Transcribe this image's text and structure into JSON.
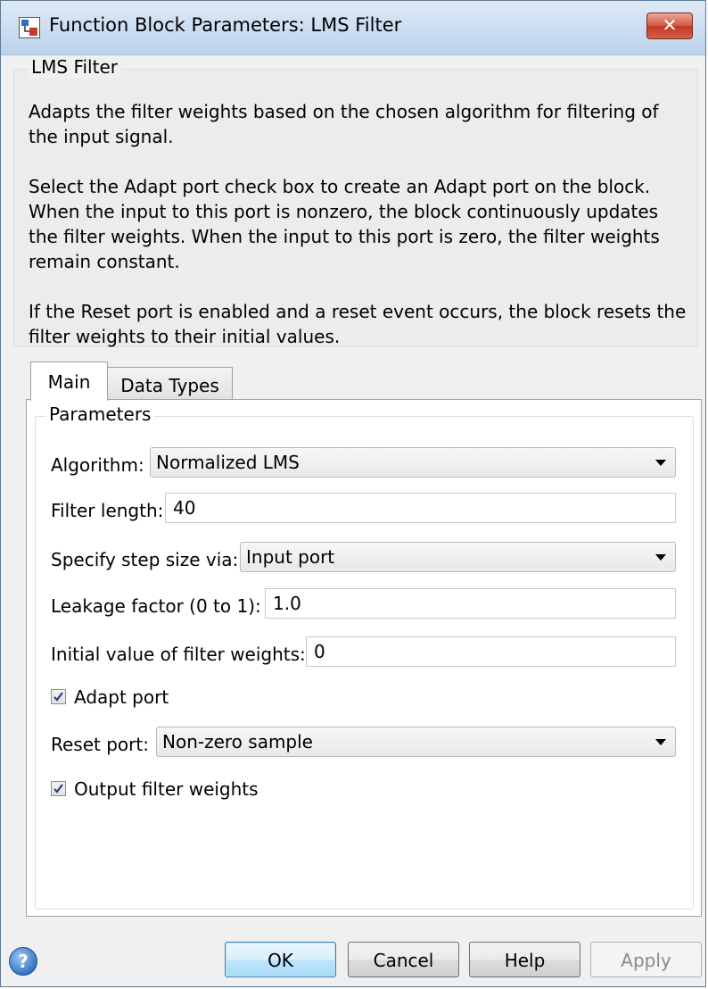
{
  "window": {
    "title": "Function Block Parameters: LMS Filter",
    "close_glyph": "✕"
  },
  "description": {
    "legend": "LMS Filter",
    "paragraphs": [
      "Adapts the filter weights based on the chosen algorithm for filtering of the input signal.",
      "Select the Adapt port check box to create an Adapt port on the block. When the input to this port is nonzero, the block continuously updates the filter weights. When the input to this port is zero, the filter weights remain constant.",
      "If the Reset port is enabled and a reset event occurs, the block resets the filter weights to their initial values."
    ]
  },
  "tabs": [
    {
      "label": "Main",
      "selected": true
    },
    {
      "label": "Data Types",
      "selected": false
    }
  ],
  "parameters": {
    "legend": "Parameters",
    "algorithm": {
      "label": "Algorithm:",
      "value": "Normalized LMS"
    },
    "filter_length": {
      "label": "Filter length:",
      "value": "40"
    },
    "step_size": {
      "label": "Specify step size via:",
      "value": "Input port"
    },
    "leakage": {
      "label": "Leakage factor (0 to 1):",
      "value": "1.0"
    },
    "initial_weights": {
      "label": "Initial value of filter weights:",
      "value": "0"
    },
    "adapt_port": {
      "label": "Adapt port",
      "checked": true
    },
    "reset_port": {
      "label": "Reset port:",
      "value": "Non-zero sample"
    },
    "output_weights": {
      "label": "Output filter weights",
      "checked": true
    }
  },
  "buttons": {
    "ok": "OK",
    "cancel": "Cancel",
    "help": "Help",
    "apply": "Apply"
  },
  "colors": {
    "ok_border": "#3c7fb1",
    "close_red": "#c23a24",
    "help_blue": "#2f6fc1"
  }
}
